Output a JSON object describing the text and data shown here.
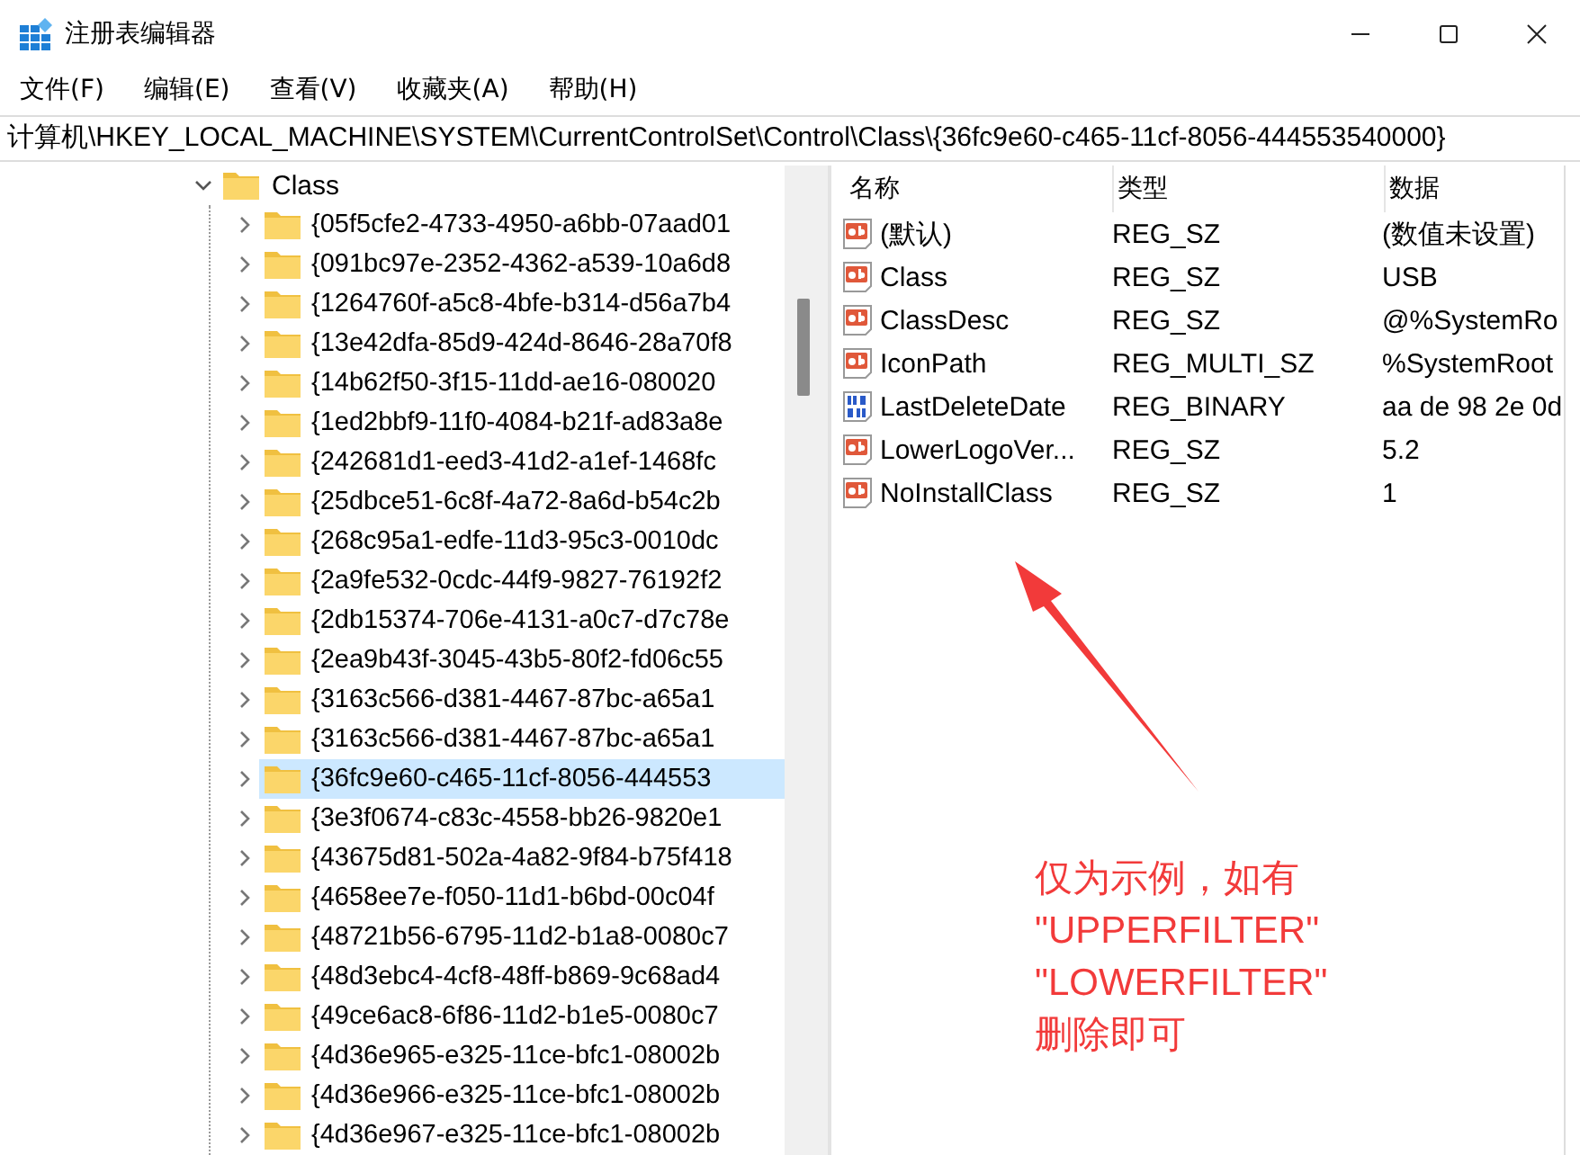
{
  "window": {
    "title": "注册表编辑器"
  },
  "menu": [
    "文件(F)",
    "编辑(E)",
    "查看(V)",
    "收藏夹(A)",
    "帮助(H)"
  ],
  "address": "计算机\\HKEY_LOCAL_MACHINE\\SYSTEM\\CurrentControlSet\\Control\\Class\\{36fc9e60-c465-11cf-8056-444553540000}",
  "tree": [
    {
      "label": "Class",
      "expanded": true,
      "selected": false,
      "children": [
        {
          "label": "{05f5cfe2-4733-4950-a6bb-07aad01",
          "expanded": false,
          "selected": false
        },
        {
          "label": "{091bc97e-2352-4362-a539-10a6d8",
          "expanded": false,
          "selected": false
        },
        {
          "label": "{1264760f-a5c8-4bfe-b314-d56a7b4",
          "expanded": false,
          "selected": false
        },
        {
          "label": "{13e42dfa-85d9-424d-8646-28a70f8",
          "expanded": false,
          "selected": false
        },
        {
          "label": "{14b62f50-3f15-11dd-ae16-080020",
          "expanded": false,
          "selected": false
        },
        {
          "label": "{1ed2bbf9-11f0-4084-b21f-ad83a8e",
          "expanded": false,
          "selected": false
        },
        {
          "label": "{242681d1-eed3-41d2-a1ef-1468fc",
          "expanded": false,
          "selected": false
        },
        {
          "label": "{25dbce51-6c8f-4a72-8a6d-b54c2b",
          "expanded": false,
          "selected": false
        },
        {
          "label": "{268c95a1-edfe-11d3-95c3-0010dc",
          "expanded": false,
          "selected": false
        },
        {
          "label": "{2a9fe532-0cdc-44f9-9827-76192f2",
          "expanded": false,
          "selected": false
        },
        {
          "label": "{2db15374-706e-4131-a0c7-d7c78e",
          "expanded": false,
          "selected": false
        },
        {
          "label": "{2ea9b43f-3045-43b5-80f2-fd06c55",
          "expanded": false,
          "selected": false
        },
        {
          "label": "{3163c566-d381-4467-87bc-a65a1",
          "expanded": false,
          "selected": false
        },
        {
          "label": "{3163c566-d381-4467-87bc-a65a1",
          "expanded": false,
          "selected": false
        },
        {
          "label": "{36fc9e60-c465-11cf-8056-444553",
          "expanded": false,
          "selected": true
        },
        {
          "label": "{3e3f0674-c83c-4558-bb26-9820e1",
          "expanded": false,
          "selected": false
        },
        {
          "label": "{43675d81-502a-4a82-9f84-b75f418",
          "expanded": false,
          "selected": false
        },
        {
          "label": "{4658ee7e-f050-11d1-b6bd-00c04f",
          "expanded": false,
          "selected": false
        },
        {
          "label": "{48721b56-6795-11d2-b1a8-0080c7",
          "expanded": false,
          "selected": false
        },
        {
          "label": "{48d3ebc4-4cf8-48ff-b869-9c68ad4",
          "expanded": false,
          "selected": false
        },
        {
          "label": "{49ce6ac8-6f86-11d2-b1e5-0080c7",
          "expanded": false,
          "selected": false
        },
        {
          "label": "{4d36e965-e325-11ce-bfc1-08002b",
          "expanded": false,
          "selected": false
        },
        {
          "label": "{4d36e966-e325-11ce-bfc1-08002b",
          "expanded": false,
          "selected": false
        },
        {
          "label": "{4d36e967-e325-11ce-bfc1-08002b",
          "expanded": false,
          "selected": false
        }
      ]
    }
  ],
  "columns": [
    "名称",
    "类型",
    "数据"
  ],
  "values": [
    {
      "name": "(默认)",
      "type": "REG_SZ",
      "data": "(数值未设置)",
      "kind": "string"
    },
    {
      "name": "Class",
      "type": "REG_SZ",
      "data": "USB",
      "kind": "string"
    },
    {
      "name": "ClassDesc",
      "type": "REG_SZ",
      "data": "@%SystemRo",
      "kind": "string"
    },
    {
      "name": "IconPath",
      "type": "REG_MULTI_SZ",
      "data": "%SystemRoot",
      "kind": "string"
    },
    {
      "name": "LastDeleteDate",
      "type": "REG_BINARY",
      "data": "aa de 98 2e 0d",
      "kind": "binary"
    },
    {
      "name": "LowerLogoVer...",
      "type": "REG_SZ",
      "data": "5.2",
      "kind": "string"
    },
    {
      "name": "NoInstallClass",
      "type": "REG_SZ",
      "data": "1",
      "kind": "string"
    }
  ],
  "annotation": {
    "lines": [
      "仅为示例，如有",
      "\"UPPERFILTER\"",
      "\"LOWERFILTER\"",
      "删除即可"
    ]
  }
}
